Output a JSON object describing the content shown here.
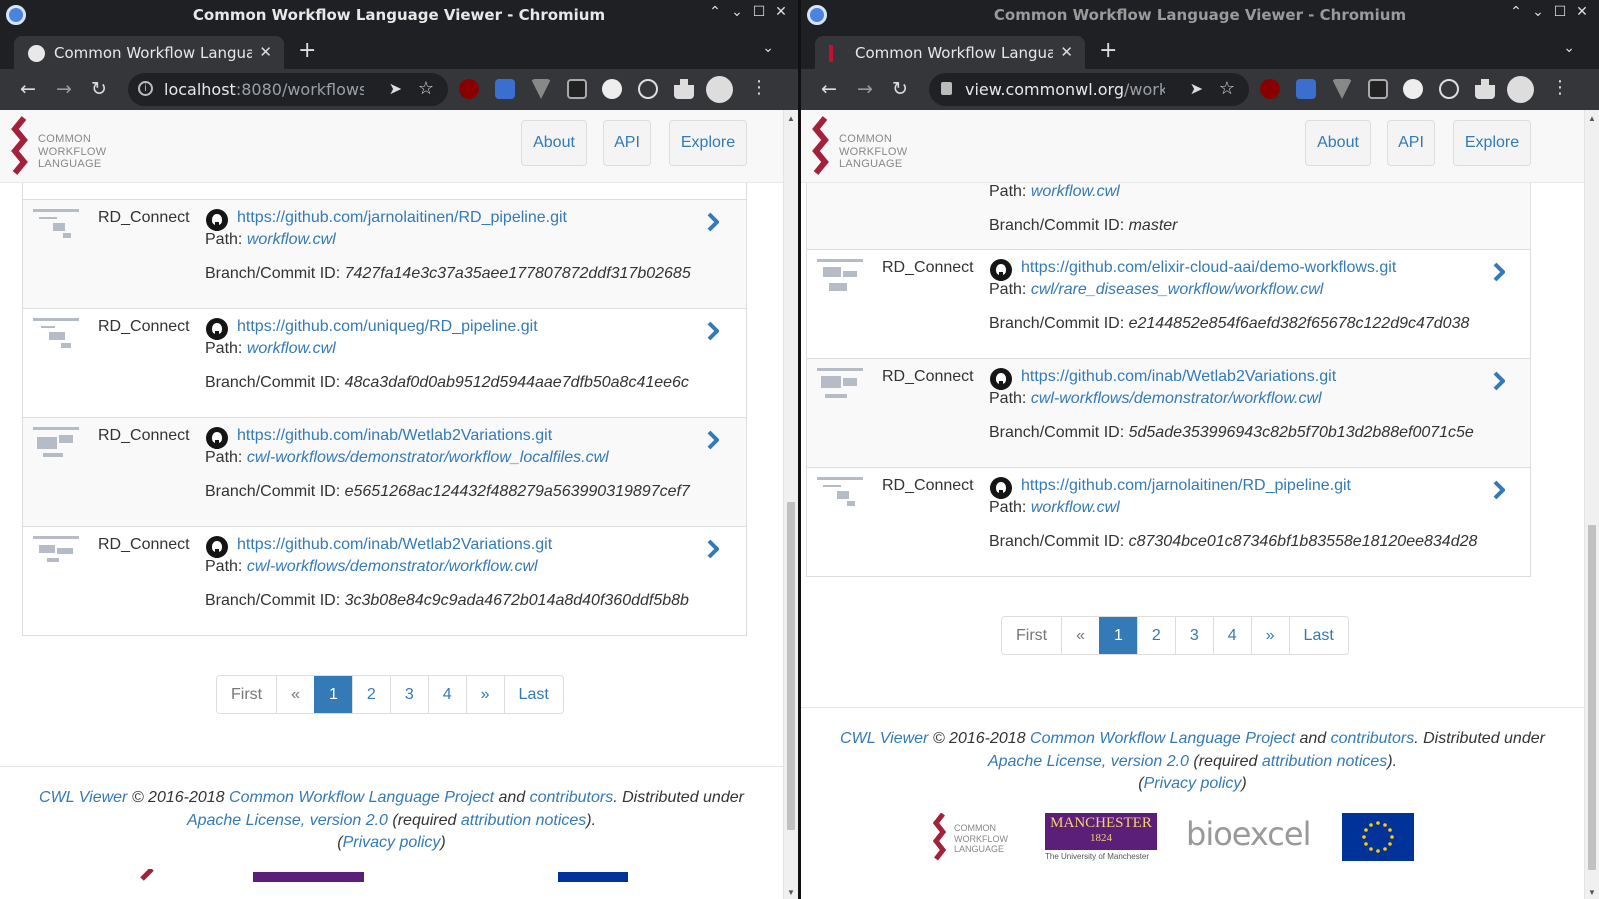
{
  "left": {
    "window_title": "Common Workflow Language Viewer - Chromium",
    "tab_label": "Common Workflow Language Viewer",
    "url_host": "localhost",
    "url_rest": ":8080/workflows...",
    "nav": {
      "about": "About",
      "api": "API",
      "explore": "Explore"
    },
    "logo_lines": [
      "COMMON",
      "WORKFLOW",
      "LANGUAGE"
    ],
    "rows": [
      {
        "name": "RD_Connect",
        "repo": "https://github.com/jarnolaitinen/RD_pipeline.git",
        "path_label": "Path:",
        "path": "workflow.cwl",
        "branch_label": "Branch/Commit ID:",
        "branch": "7427fa14e3c37a35aee177807872ddf317b02685"
      },
      {
        "name": "RD_Connect",
        "repo": "https://github.com/uniqueg/RD_pipeline.git",
        "path_label": "Path:",
        "path": "workflow.cwl",
        "branch_label": "Branch/Commit ID:",
        "branch": "48ca3daf0d0ab9512d5944aae7dfb50a8c41ee6c"
      },
      {
        "name": "RD_Connect",
        "repo": "https://github.com/inab/Wetlab2Variations.git",
        "path_label": "Path:",
        "path": "cwl-workflows/demonstrator/workflow_localfiles.cwl",
        "branch_label": "Branch/Commit ID:",
        "branch": "e5651268ac124432f488279a563990319897cef7"
      },
      {
        "name": "RD_Connect",
        "repo": "https://github.com/inab/Wetlab2Variations.git",
        "path_label": "Path:",
        "path": "cwl-workflows/demonstrator/workflow.cwl",
        "branch_label": "Branch/Commit ID:",
        "branch": "3c3b08e84c9c9ada4672b014a8d40f360ddf5b8b"
      }
    ],
    "pager": {
      "first": "First",
      "prev": "«",
      "pages": [
        "1",
        "2",
        "3",
        "4"
      ],
      "next": "»",
      "last": "Last"
    },
    "footer": {
      "cwl_viewer": "CWL Viewer",
      "copy": " © 2016-2018 ",
      "project": "Common Workflow Language Project",
      "and": " and ",
      "contributors": "contributors",
      "dist": ". Distributed under",
      "license": "Apache License, version 2.0",
      "req_open": " (required ",
      "attribution": "attribution notices",
      "req_close": ").",
      "paren_open": "(",
      "privacy": "Privacy policy",
      "paren_close": ")"
    }
  },
  "right": {
    "window_title": "Common Workflow Language Viewer - Chromium",
    "tab_label": "Common Workflow Language Viewer",
    "url_host": "view.commonwl.org",
    "url_rest": "/work...",
    "nav": {
      "about": "About",
      "api": "API",
      "explore": "Explore"
    },
    "logo_lines": [
      "COMMON",
      "WORKFLOW",
      "LANGUAGE"
    ],
    "partial_row": {
      "path_label": "Path:",
      "path": "workflow.cwl",
      "branch_label": "Branch/Commit ID:",
      "branch": "master"
    },
    "rows": [
      {
        "name": "RD_Connect",
        "repo": "https://github.com/elixir-cloud-aai/demo-workflows.git",
        "path_label": "Path:",
        "path": "cwl/rare_diseases_workflow/workflow.cwl",
        "branch_label": "Branch/Commit ID:",
        "branch": "e2144852e854f6aefd382f65678c122d9c47d038"
      },
      {
        "name": "RD_Connect",
        "repo": "https://github.com/inab/Wetlab2Variations.git",
        "path_label": "Path:",
        "path": "cwl-workflows/demonstrator/workflow.cwl",
        "branch_label": "Branch/Commit ID:",
        "branch": "5d5ade353996943c82b5f70b13d2b88ef0071c5e"
      },
      {
        "name": "RD_Connect",
        "repo": "https://github.com/jarnolaitinen/RD_pipeline.git",
        "path_label": "Path:",
        "path": "workflow.cwl",
        "branch_label": "Branch/Commit ID:",
        "branch": "c87304bce01c87346bf1b83558e18120ee834d28"
      }
    ],
    "pager": {
      "first": "First",
      "prev": "«",
      "pages": [
        "1",
        "2",
        "3",
        "4"
      ],
      "next": "»",
      "last": "Last"
    },
    "footer": {
      "cwl_viewer": "CWL Viewer",
      "copy": " © 2016-2018 ",
      "project": "Common Workflow Language Project",
      "and": " and ",
      "contributors": "contributors",
      "dist": ". Distributed under",
      "license": "Apache License, version 2.0",
      "req_open": " (required ",
      "attribution": "attribution notices",
      "req_close": ").",
      "paren_open": "(",
      "privacy": "Privacy policy",
      "paren_close": ")"
    },
    "partner_logos": {
      "cwl": [
        "COMMON",
        "WORKFLOW",
        "LANGUAGE"
      ],
      "manchester": "MANCHESTER",
      "manchester_year": "1824",
      "manchester_sub": "The University of Manchester",
      "bioexcel": "bioexcel"
    }
  },
  "colors": {
    "link": "#337ab7",
    "active_page": "#337ab7",
    "cwl_red": "#a3213a",
    "manchester_purple": "#5b1f7a",
    "eu_blue": "#003399"
  }
}
